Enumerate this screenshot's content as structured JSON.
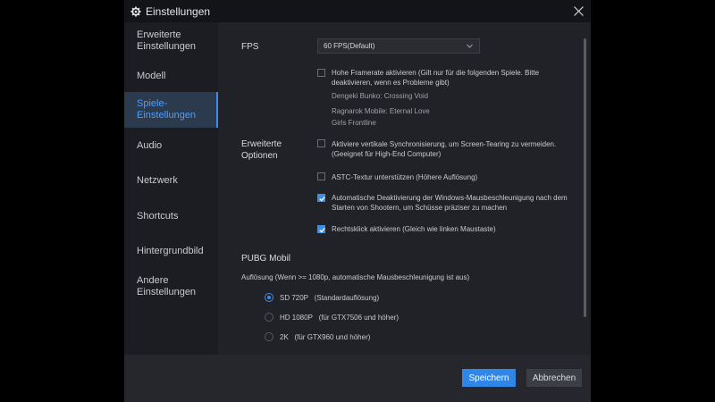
{
  "window": {
    "title": "Einstellungen"
  },
  "sidebar": {
    "items": [
      {
        "label": "Erweiterte\nEinstellungen"
      },
      {
        "label": "Modell"
      },
      {
        "label": "Spiele-\nEinstellungen"
      },
      {
        "label": "Audio"
      },
      {
        "label": "Netzwerk"
      },
      {
        "label": "Shortcuts"
      },
      {
        "label": "Hintergrundbild"
      },
      {
        "label": "Andere\nEinstellungen"
      }
    ]
  },
  "fps": {
    "label": "FPS",
    "select_value": "60 FPS(Default)"
  },
  "high_framerate": {
    "label": "Hohe Framerate aktivieren  (Gilt nur für die folgenden Spiele. Bitte deaktivieren, wenn es Probleme gibt)",
    "checked": false,
    "games": [
      "Dengeki Bunko: Crossing Void",
      "Ragnarok Mobile: Eternal Love",
      "Girls Frontline"
    ]
  },
  "advanced": {
    "label": "Erweiterte\nOptionen",
    "options": [
      {
        "label": "Aktiviere vertikale Synchronisierung, um Screen-Tearing zu vermeiden.  (Geeignet für High-End Computer)",
        "checked": false
      },
      {
        "label": "ASTC-Textur unterstützen  (Höhere Auflösung)",
        "checked": false
      },
      {
        "label": "Automatische Deaktivierung der Windows-Mausbeschleunigung nach dem Starten von Shootern, um Schüsse präziser zu machen",
        "checked": true
      },
      {
        "label": "Rechtsklick aktivieren (Gleich wie linken Maustaste)",
        "checked": true
      }
    ]
  },
  "pubg": {
    "title": "PUBG Mobil",
    "resolution_label": "Auflösung (Wenn >= 1080p, automatische Mausbeschleunigung ist aus)",
    "options": [
      {
        "name": "SD 720P",
        "note": "(Standardauflösung)",
        "selected": true
      },
      {
        "name": "HD 1080P",
        "note": "(für GTX7506 und höher)",
        "selected": false
      },
      {
        "name": "2K",
        "note": "(für GTX960 und höher)",
        "selected": false
      }
    ]
  },
  "footer": {
    "save_label": "Speichern",
    "cancel_label": "Abbrechen"
  },
  "colors": {
    "accent": "#3a8ee6",
    "active_bg": "#2b3a4d",
    "dialog_bg": "#202227"
  }
}
